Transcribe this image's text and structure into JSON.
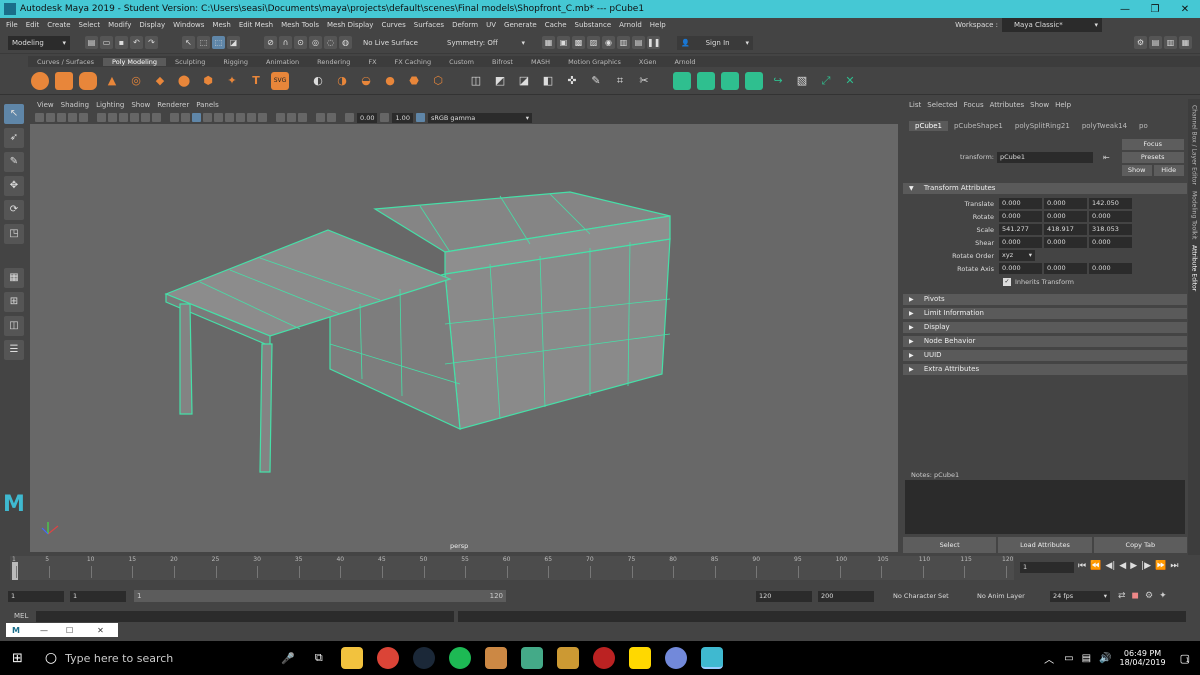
{
  "window": {
    "title": "Autodesk Maya 2019 - Student Version: C:\\Users\\seasi\\Documents\\maya\\projects\\default\\scenes\\Final models\\Shopfront_C.mb*  ---  pCube1",
    "minimize": "—",
    "maximize": "❐",
    "close": "✕"
  },
  "menu": {
    "items": [
      "File",
      "Edit",
      "Create",
      "Select",
      "Modify",
      "Display",
      "Windows",
      "Mesh",
      "Edit Mesh",
      "Mesh Tools",
      "Mesh Display",
      "Curves",
      "Surfaces",
      "Deform",
      "UV",
      "Generate",
      "Cache",
      "Substance",
      "Arnold",
      "Help"
    ],
    "workspace_label": "Workspace :",
    "workspace_value": "Maya Classic*"
  },
  "statusline": {
    "mode": "Modeling",
    "live_surface": "No Live Surface",
    "symmetry": "Symmetry: Off",
    "sign_in": "Sign In"
  },
  "shelf": {
    "tabs": [
      "Curves / Surfaces",
      "Poly Modeling",
      "Sculpting",
      "Rigging",
      "Animation",
      "Rendering",
      "FX",
      "FX Caching",
      "Custom",
      "Bifrost",
      "MASH",
      "Motion Graphics",
      "XGen",
      "Arnold"
    ],
    "active_tab": "Poly Modeling",
    "icons": [
      "poly-sphere",
      "poly-cube",
      "poly-cylinder",
      "poly-cone",
      "poly-torus",
      "poly-plane",
      "poly-disc",
      "platonic-solid",
      "super-shape",
      "type",
      "svg",
      "combine",
      "separate",
      "extract",
      "smooth",
      "bridge",
      "multi-cut",
      "target-weld",
      "quad-draw",
      "uv-editor",
      "planar-map",
      "automatic-map",
      "cut-uv",
      "sew-uv",
      "unfold",
      "layout",
      "transfer"
    ]
  },
  "viewport": {
    "menu": [
      "View",
      "Shading",
      "Lighting",
      "Show",
      "Renderer",
      "Panels"
    ],
    "exposure": "0.00",
    "gamma": "1.00",
    "colorspace": "sRGB gamma",
    "camera_label": "persp"
  },
  "attribute_editor": {
    "menu": [
      "List",
      "Selected",
      "Focus",
      "Attributes",
      "Show",
      "Help"
    ],
    "tabs": [
      "pCube1",
      "pCubeShape1",
      "polySplitRing21",
      "polyTweak14",
      "po"
    ],
    "transform_label": "transform:",
    "transform_value": "pCube1",
    "focus_btn": "Focus",
    "presets_btn": "Presets",
    "show_btn": "Show",
    "hide_btn": "Hide",
    "transform_section": "Transform Attributes",
    "rows": [
      {
        "label": "Translate",
        "values": [
          "0.000",
          "0.000",
          "142.050"
        ]
      },
      {
        "label": "Rotate",
        "values": [
          "0.000",
          "0.000",
          "0.000"
        ]
      },
      {
        "label": "Scale",
        "values": [
          "541.277",
          "418.917",
          "318.053"
        ]
      },
      {
        "label": "Shear",
        "values": [
          "0.000",
          "0.000",
          "0.000"
        ]
      }
    ],
    "rotate_order_label": "Rotate Order",
    "rotate_order_value": "xyz",
    "rotate_axis_label": "Rotate Axis",
    "rotate_axis_values": [
      "0.000",
      "0.000",
      "0.000"
    ],
    "inherits_label": "Inherits Transform",
    "collapsed_sections": [
      "Pivots",
      "Limit Information",
      "Display",
      "Node Behavior",
      "UUID",
      "Extra Attributes"
    ],
    "notes_label": "Notes:  pCube1",
    "bottom_buttons": [
      "Select",
      "Load Attributes",
      "Copy Tab"
    ],
    "side_tabs": [
      "Channel Box / Layer Editor",
      "Modeling Toolkit",
      "Attribute Editor"
    ]
  },
  "timeline": {
    "ticks": [
      "1",
      "5",
      "10",
      "15",
      "20",
      "25",
      "30",
      "35",
      "40",
      "45",
      "50",
      "55",
      "60",
      "65",
      "70",
      "75",
      "80",
      "85",
      "90",
      "95",
      "100",
      "105",
      "110",
      "115",
      "120"
    ],
    "current_frame": "1",
    "range_start": "1",
    "range_inner_start": "1",
    "range_slider_start": "1",
    "range_slider_end": "120",
    "range_end": "120",
    "anim_end": "200",
    "character_set": "No Character Set",
    "anim_layer": "No Anim Layer",
    "fps": "24 fps"
  },
  "mel": {
    "label": "MEL"
  },
  "taskbar": {
    "search_placeholder": "Type here to search",
    "time": "06:49 PM",
    "date": "18/04/2019",
    "notification_count": "1"
  }
}
